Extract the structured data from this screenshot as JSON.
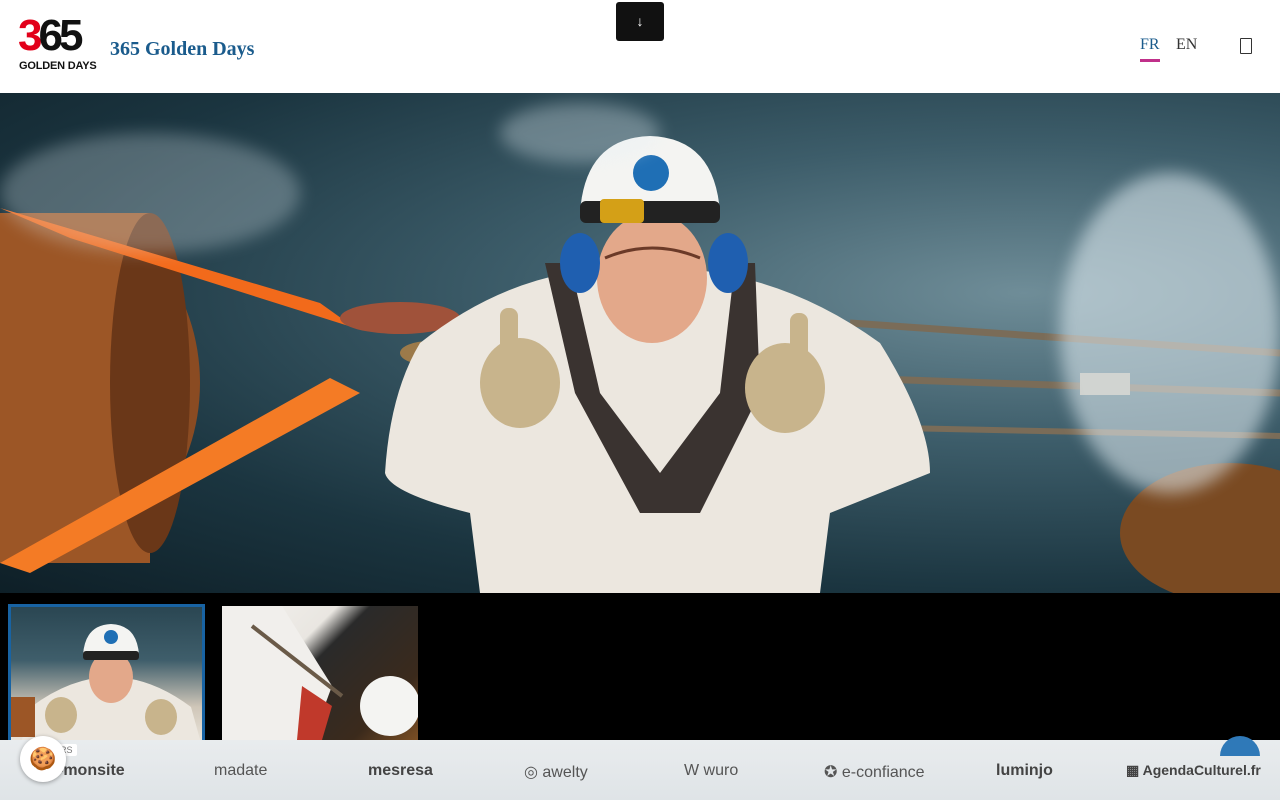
{
  "header": {
    "logo_number": "365",
    "logo_number_red": "3",
    "logo_number_dark": "65",
    "logo_subtitle": "GOLDEN DAYS",
    "site_title": "365 Golden Days",
    "download_icon": "↓",
    "languages": [
      {
        "code": "FR",
        "active": true
      },
      {
        "code": "EN",
        "active": false
      }
    ],
    "menu_icon": "menu-icon"
  },
  "hero": {
    "image": "rope-access-worker-thumbs-up"
  },
  "gallery": {
    "thumbnails": [
      {
        "name": "worker-thumbs-up",
        "selected": true
      },
      {
        "name": "worker-climbing",
        "selected": false
      }
    ]
  },
  "partners": {
    "badge": "RS",
    "logos": [
      "-monsite",
      "madate",
      "mesresa",
      "awelty",
      "wuro",
      "e-confiance",
      "luminjo",
      "AgendaCulturel.fr"
    ]
  },
  "cookie": {
    "icon": "🍪"
  },
  "colors": {
    "brand_red": "#e2001a",
    "title_blue": "#1a5b8c",
    "lang_underline": "#c0308a",
    "thumb_border": "#1863a3"
  }
}
